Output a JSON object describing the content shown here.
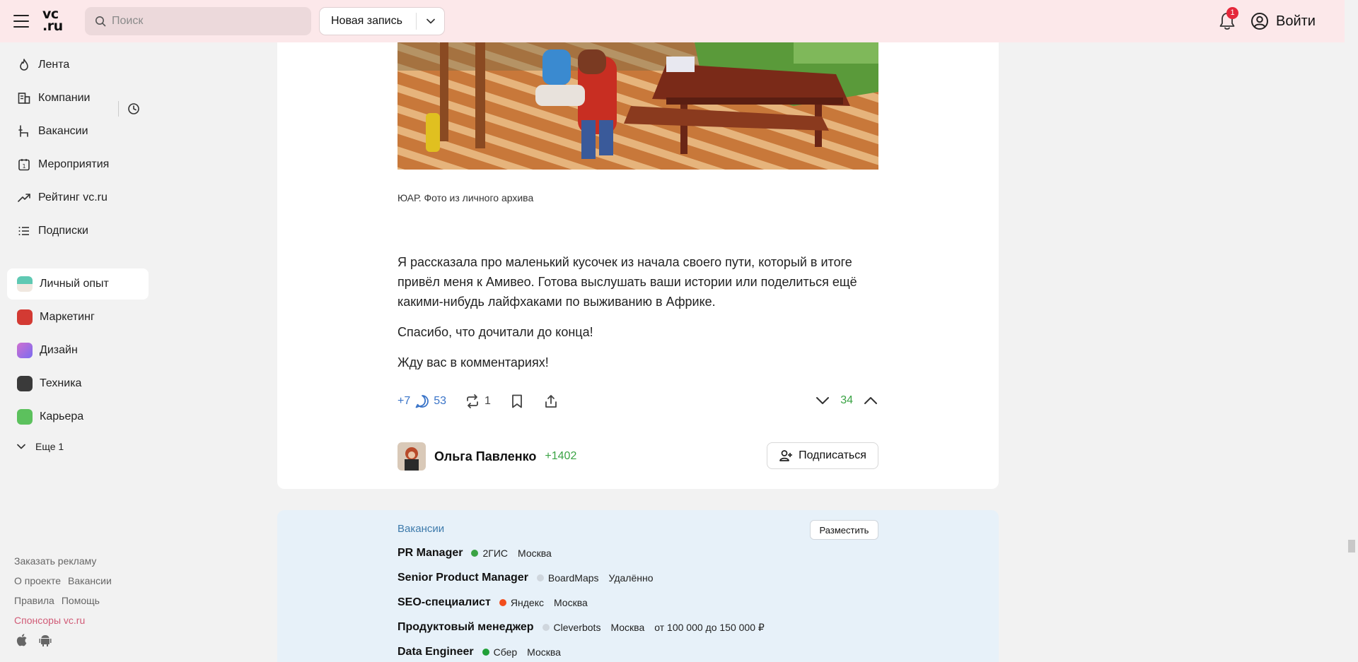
{
  "header": {
    "logo_line1": "vc",
    "logo_line2": ".ru",
    "search_placeholder": "Поиск",
    "new_post_label": "Новая запись",
    "notification_count": "1",
    "login_label": "Войти"
  },
  "sidebar": {
    "nav": [
      {
        "label": "Лента",
        "icon": "fire-icon"
      },
      {
        "label": "Компании",
        "icon": "building-icon"
      },
      {
        "label": "Вакансии",
        "icon": "chair-icon"
      },
      {
        "label": "Мероприятия",
        "icon": "calendar-icon"
      },
      {
        "label": "Рейтинг vc.ru",
        "icon": "trend-icon"
      },
      {
        "label": "Подписки",
        "icon": "list-icon"
      }
    ],
    "subsites": [
      {
        "label": "Личный опыт",
        "color": "#5fc9b3"
      },
      {
        "label": "Маркетинг",
        "color": "#d33a33"
      },
      {
        "label": "Дизайн",
        "color": "#a46bf0"
      },
      {
        "label": "Техника",
        "color": "#3a3a3a"
      },
      {
        "label": "Карьера",
        "color": "#5cc15d"
      }
    ],
    "more_label": "Еще 1",
    "footer": {
      "ads": "Заказать рекламу",
      "about": "О проекте",
      "jobs": "Вакансии",
      "rules": "Правила",
      "help": "Помощь",
      "sponsors": "Спонсоры vc.ru"
    }
  },
  "article": {
    "caption": "ЮАР. Фото из личного архива",
    "paragraphs": [
      "Я рассказала про маленький кусочек из начала своего пути, который в итоге привёл меня к Амивео. Готова выслушать ваши истории или поделиться ещё какими-нибудь лайфхаками по выживанию в Африке.",
      "Спасибо, что дочитали до конца!",
      "Жду вас в комментариях!"
    ],
    "likes": "+7",
    "comments": "53",
    "reposts": "1",
    "rating": "34",
    "author_name": "Ольга Павленко",
    "author_karma": "+1402",
    "subscribe_label": "Подписаться"
  },
  "jobs": {
    "title": "Вакансии",
    "place_label": "Разместить",
    "items": [
      {
        "title": "PR Manager",
        "company": "2ГИС",
        "location": "Москва",
        "salary": "",
        "color": "#3aa344"
      },
      {
        "title": "Senior Product Manager",
        "company": "BoardMaps",
        "location": "Удалённо",
        "salary": "",
        "color": "#cfd6dd"
      },
      {
        "title": "SEO-специалист",
        "company": "Яндекс",
        "location": "Москва",
        "salary": "",
        "color": "#f24e1e"
      },
      {
        "title": "Продуктовый менеджер",
        "company": "Cleverbots",
        "location": "Москва",
        "salary": "от 100 000 до 150 000 ₽",
        "color": "#cfd6dd"
      },
      {
        "title": "Data Engineer",
        "company": "Сбер",
        "location": "Москва",
        "salary": "",
        "color": "#21a038"
      }
    ]
  }
}
